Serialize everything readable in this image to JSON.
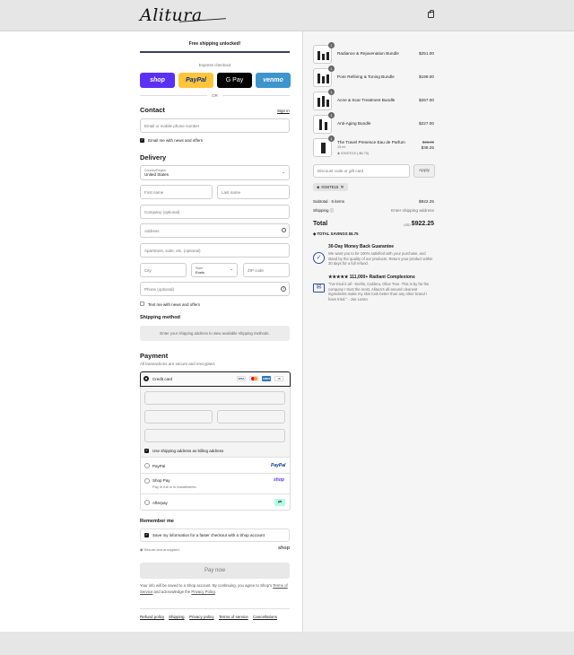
{
  "brand": {
    "logo_text": "Alitura"
  },
  "banner": {
    "text": "Free shipping unlocked!"
  },
  "express": {
    "label": "Express checkout",
    "buttons": [
      {
        "label": "shop",
        "color": "#5a31f4"
      },
      {
        "label": "PayPal",
        "color": "#ffc439"
      },
      {
        "label": "G Pay",
        "color": "#000000"
      },
      {
        "label": "venmo",
        "color": "#3d95ce"
      }
    ],
    "or_label": "OR"
  },
  "contact": {
    "title": "Contact",
    "sign_in": "Sign in",
    "email_placeholder": "Email or mobile phone number",
    "news_label": "Email me with news and offers"
  },
  "delivery": {
    "title": "Delivery",
    "country_label": "Country/Region",
    "country_value": "United States",
    "first_name": "First name",
    "last_name": "Last name",
    "company": "Company (optional)",
    "address": "Address",
    "apartment": "Apartment, suite, etc. (optional)",
    "city": "City",
    "state_label": "State",
    "state_value": "Enels",
    "zip": "ZIP code",
    "phone": "Phone (optional)",
    "text_label": "Text me with news and offers"
  },
  "shipping_method": {
    "title": "Shipping method",
    "message": "Enter your shipping address to view available shipping methods."
  },
  "payment": {
    "title": "Payment",
    "subtitle": "All transactions are secure and encrypted.",
    "credit_card": "Credit card",
    "card_brands": [
      "VISA",
      "MC",
      "AMEX",
      "+5"
    ],
    "billing_label": "Use shipping address as billing address",
    "paypal": "PayPal",
    "paypal_logo": "PayPal",
    "shop_pay": "Shop Pay",
    "shop_pay_sub": "Pay in full or in installments",
    "shop_logo": "shop",
    "afterpay": "Afterpay"
  },
  "remember": {
    "title": "Remember me",
    "save_label": "Save my information for a faster checkout with a Shop account",
    "secure_label": "Secure and encrypted",
    "shop_logo": "shop"
  },
  "pay_now": "Pay now",
  "legal": {
    "text1": "Your info will be saved to a Shop account. By continuing, you agree to Shop's",
    "terms": "Terms of Service",
    "text2": "and acknowledge the",
    "privacy": "Privacy Policy",
    "text3": "."
  },
  "footer_links": [
    "Refund policy",
    "Shipping",
    "Privacy policy",
    "Terms of service",
    "Cancellations"
  ],
  "cart": {
    "items": [
      {
        "qty": "1",
        "name": "Radiance & Rejuvenation Bundle",
        "price": "$251.00"
      },
      {
        "qty": "1",
        "name": "Pore Refining & Toning Bundle",
        "price": "$199.00"
      },
      {
        "qty": "1",
        "name": "Acne & Scar Treatment Bundle",
        "price": "$267.00"
      },
      {
        "qty": "1",
        "name": "Anti-Aging Bundle",
        "price": "$227.00"
      },
      {
        "qty": "1",
        "name": "The Travel Presence Eau de Parfum",
        "sub": "15 ml",
        "discount_code": "IGNITE15 (-$6.75)",
        "orig_price": "$45.00",
        "price": "$38.25"
      }
    ],
    "discount_placeholder": "Discount code or gift card",
    "apply": "Apply",
    "applied_code": "IGNITE15",
    "subtotal_label": "Subtotal · 5 items",
    "subtotal_value": "$922.25",
    "shipping_label": "Shipping",
    "shipping_value": "Enter shipping address",
    "total_label": "Total",
    "currency": "USD",
    "total_value": "$922.25",
    "savings_label": "TOTAL SAVINGS",
    "savings_value": "$6.75"
  },
  "guarantee": {
    "title": "30-Day Money Back Guarantee",
    "text": "We want you to be 100% satisfied with your purchase, and stand by the quality of our products. Return your product within 30 days for a full refund."
  },
  "reviews": {
    "title": "★★★★★ 111,000+ Radiant Complexions",
    "text": "\"I've tried it all - Kiehls, Caldera, Olive Tree. This is by far the company I trust the most. Alitura's all-around cleanest ingredients make my skin look better than any other brand I have tried.\" - Joe Lusso"
  }
}
